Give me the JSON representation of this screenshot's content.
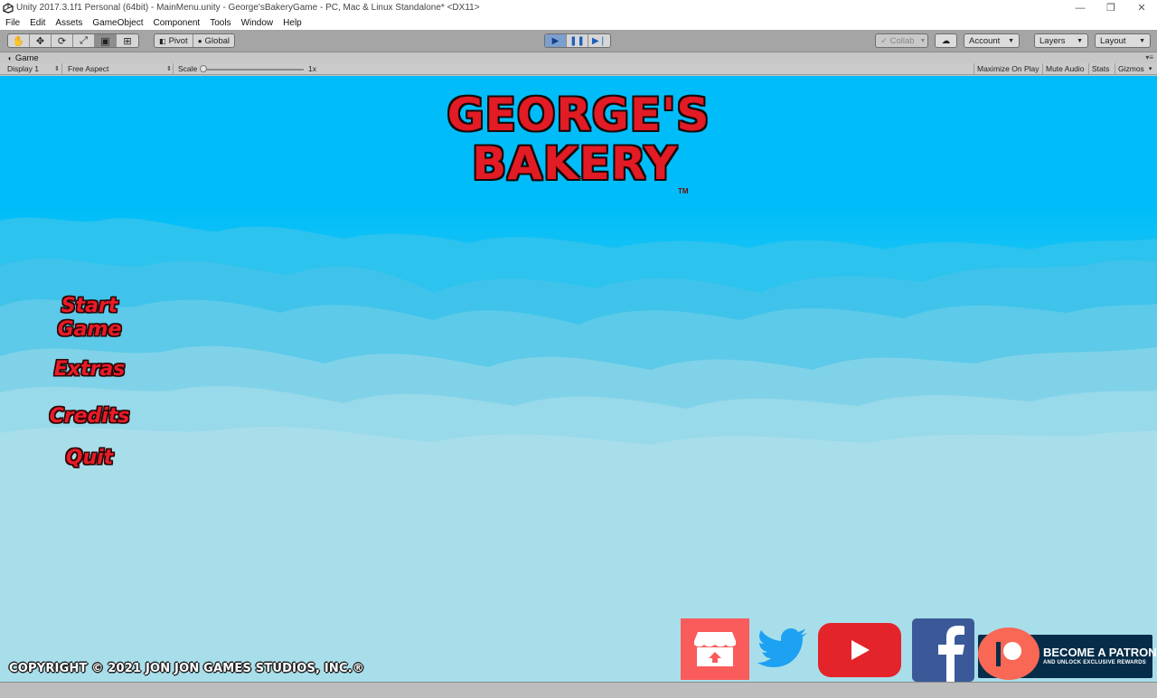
{
  "window": {
    "title": "Unity 2017.3.1f1 Personal (64bit) - MainMenu.unity - George'sBakeryGame - PC, Mac & Linux Standalone* <DX11>",
    "controls": [
      "—",
      "❐",
      "✕"
    ]
  },
  "menubar": {
    "items": [
      "File",
      "Edit",
      "Assets",
      "GameObject",
      "Component",
      "Tools",
      "Window",
      "Help"
    ]
  },
  "toolbar": {
    "tools": [
      "hand-tool",
      "move-tool",
      "rotate-tool",
      "scale-tool",
      "rect-tool",
      "transform-tool"
    ],
    "pivot_label": "Pivot",
    "global_label": "Global",
    "collab_label": "Collab",
    "account_label": "Account",
    "layers_label": "Layers",
    "layout_label": "Layout"
  },
  "game_tab": {
    "tab_label": "Game",
    "display": "Display 1",
    "aspect": "Free Aspect",
    "scale_label": "Scale",
    "scale_value": "1x",
    "maximize": "Maximize On Play",
    "mute": "Mute Audio",
    "stats": "Stats",
    "gizmos": "Gizmos"
  },
  "game": {
    "title_line1": "GEORGE'S",
    "title_line2": "BAKERY",
    "trademark": "TM",
    "menu": {
      "start_line1": "Start",
      "start_line2": "Game",
      "extras": "Extras",
      "credits": "Credits",
      "quit": "Quit"
    },
    "copyright": "COPYRIGHT © 2021 JON JON GAMES STUDIOS, INC.®",
    "patreon_line1": "BECOME A PATRON",
    "patreon_line2": "AND UNLOCK EXCLUSIVE REWARDS",
    "colors": {
      "sky": "#00bdf9",
      "title_red": "#e21b25",
      "itch": "#fa5c5c",
      "youtube": "#e3242b",
      "facebook": "#3b5998",
      "patreon_bg": "#052d49",
      "patreon_accent": "#f96854",
      "twitter": "#1da1f2"
    }
  }
}
